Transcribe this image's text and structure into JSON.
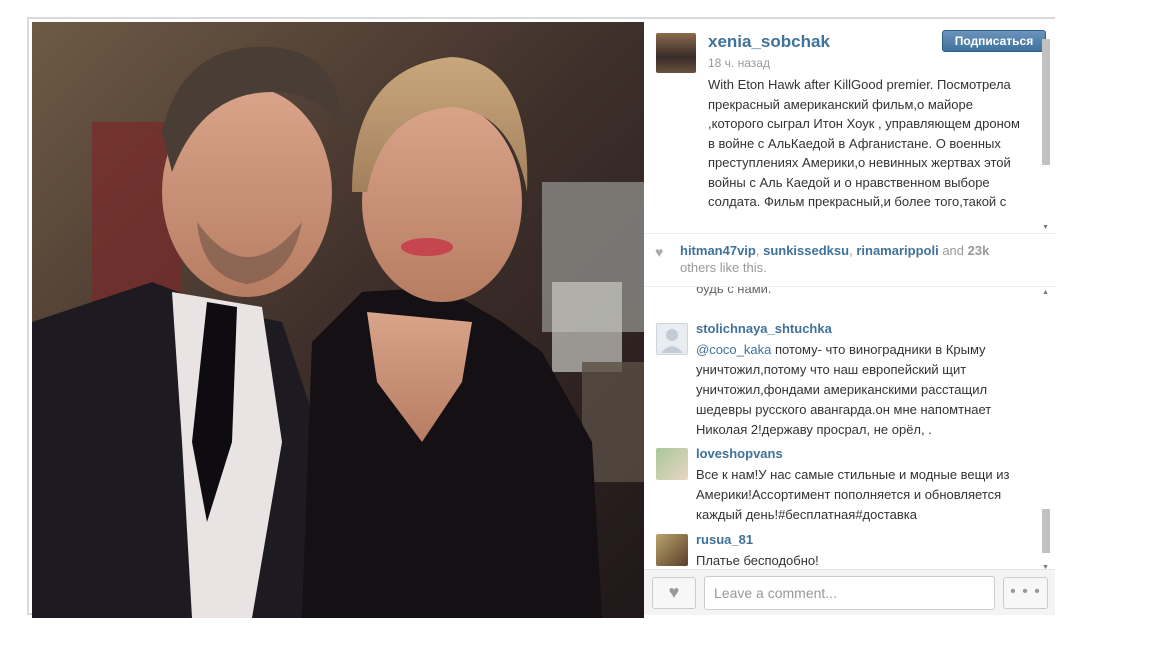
{
  "post": {
    "username": "xenia_sobchak",
    "time": "18 ч. назад",
    "follow_label": "Подписаться",
    "caption": "With Eton Hawk after KillGood premier. Посмотрела прекрасный американский фильм,о майоре ,которого сыграл Итон Хоук , управляющем дроном в войне с АльКаедой в Афганистане. О военных преступлениях Америки,о невинных жертвах этой войны с Аль Каедой и о нравственном выборе солдата. Фильм прекрасный,и более того,такой с"
  },
  "likes": {
    "users": [
      "hitman47vip",
      "sunkissedksu",
      "rinamarippoli"
    ],
    "and": "and",
    "count": "23k",
    "suffix": "others like this."
  },
  "comments": {
    "cut_text": "будь с нами.",
    "items": [
      {
        "user": "stolichnaya_shtuchka",
        "mention": "@coco_kaka",
        "text": " потому- что виноградники в Крыму уничтожил,потому что наш европейский щит уничтожил,фондами американскими расстащил шедевры русского авангарда.он мне напомтнает Николая 2!державу просрал, не орёл, ."
      },
      {
        "user": "loveshopvans",
        "mention": "",
        "text": "Все к нам!У нас самые стильные и модные вещи из Америки!Ассортимент пополняется и обновляется каждый день!#бесплатная#доставка"
      },
      {
        "user": "rusua_81",
        "mention": "",
        "text": "Платье бесподобно!"
      }
    ]
  },
  "footer": {
    "placeholder": "Leave a comment...",
    "more_label": "• • •"
  },
  "icons": {
    "heart": "heart-icon",
    "more": "ellipsis-icon"
  },
  "colors": {
    "link": "#3f729b",
    "follow_button": "#3f729b"
  }
}
